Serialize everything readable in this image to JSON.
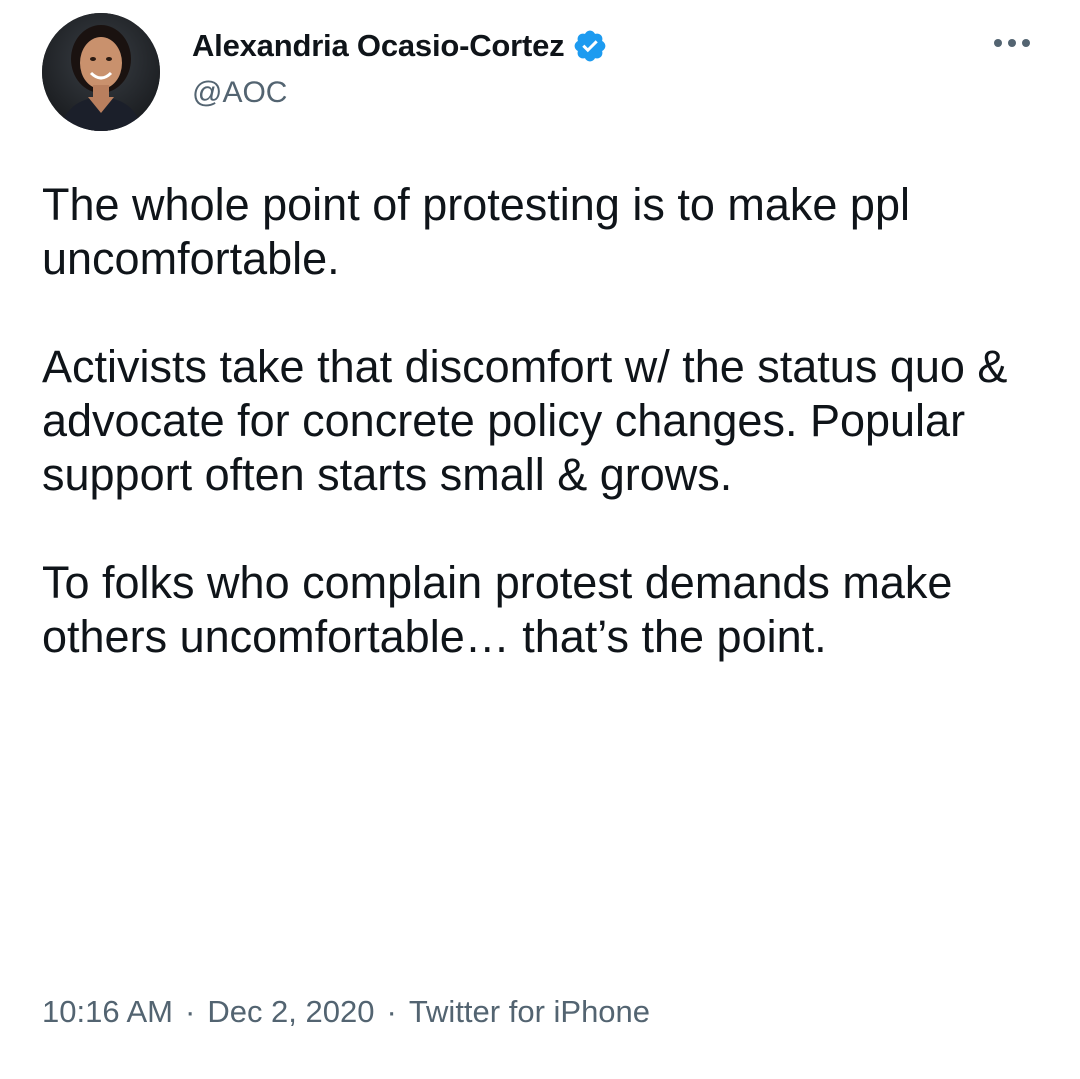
{
  "author": {
    "display_name": "Alexandria Ocasio-Cortez",
    "handle": "@AOC",
    "verified_icon": "verified-badge-icon",
    "avatar_icon": "profile-photo"
  },
  "menu": {
    "more_icon": "more-horizontal-icon"
  },
  "tweet": {
    "paragraphs": [
      "The whole point of protesting is to make ppl uncomfortable.",
      "Activists take that discomfort w/ the status quo & advocate for concrete policy changes. Popular support often starts small & grows.",
      "To folks who complain protest demands make others uncomfortable… that’s the point."
    ]
  },
  "meta": {
    "time": "10:16 AM",
    "separator": "·",
    "date": "Dec 2, 2020",
    "source": "Twitter for iPhone"
  },
  "colors": {
    "text": "#0f1419",
    "secondary": "#536471",
    "verified": "#1d9bf0"
  }
}
